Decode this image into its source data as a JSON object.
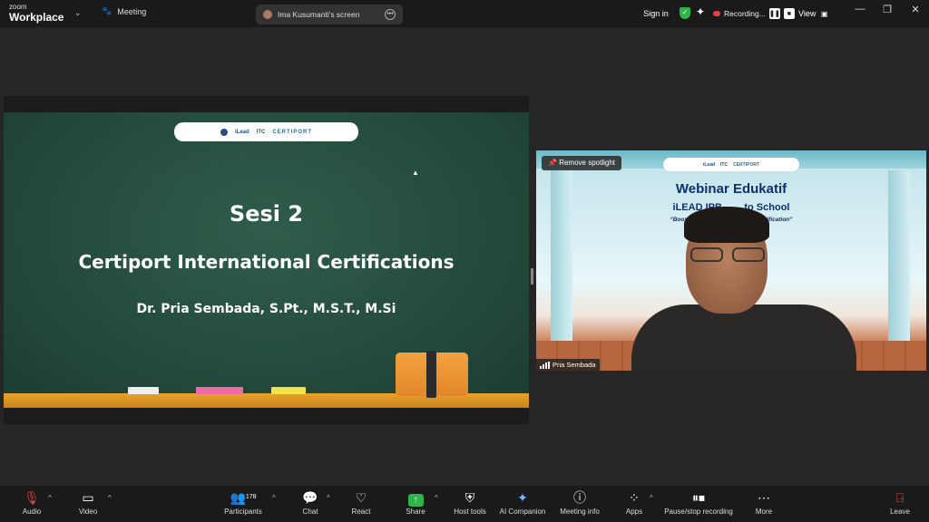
{
  "app": {
    "brand_small": "zoom",
    "brand_main": "Workplace",
    "meeting_label": "Meeting",
    "screen_tab_label": "Ima Kusumanti's screen",
    "sign_in": "Sign in",
    "recording_label": "Recording...",
    "view_label": "View"
  },
  "slide": {
    "title": "Sesi 2",
    "subtitle": "Certiport International Certifications",
    "presenter": "Dr. Pria Sembada, S.Pt., M.S.T., M.Si",
    "logos": [
      "iLead",
      "ITC",
      "CERTIPORT"
    ]
  },
  "video": {
    "spotlight_button": "Remove spotlight",
    "participant_name": "Pria Sembada",
    "bg_title": "Webinar Edukatif",
    "bg_line2": "iLEAD IPB        to School",
    "bg_line3": "“Boost Your Car                    al Certification”"
  },
  "toolbar": {
    "audio": "Audio",
    "video": "Video",
    "participants": "Participants",
    "participants_count": "178",
    "chat": "Chat",
    "react": "React",
    "share": "Share",
    "host_tools": "Host tools",
    "ai_companion": "AI Companion",
    "meeting_info": "Meeting info",
    "apps": "Apps",
    "pause_stop_recording": "Pause/stop recording",
    "more": "More",
    "leave": "Leave"
  },
  "colors": {
    "accent_green": "#2fb34b",
    "recording_red": "#e04343",
    "chalkboard": "#2f5d4a",
    "ledge": "#e9a22a"
  }
}
